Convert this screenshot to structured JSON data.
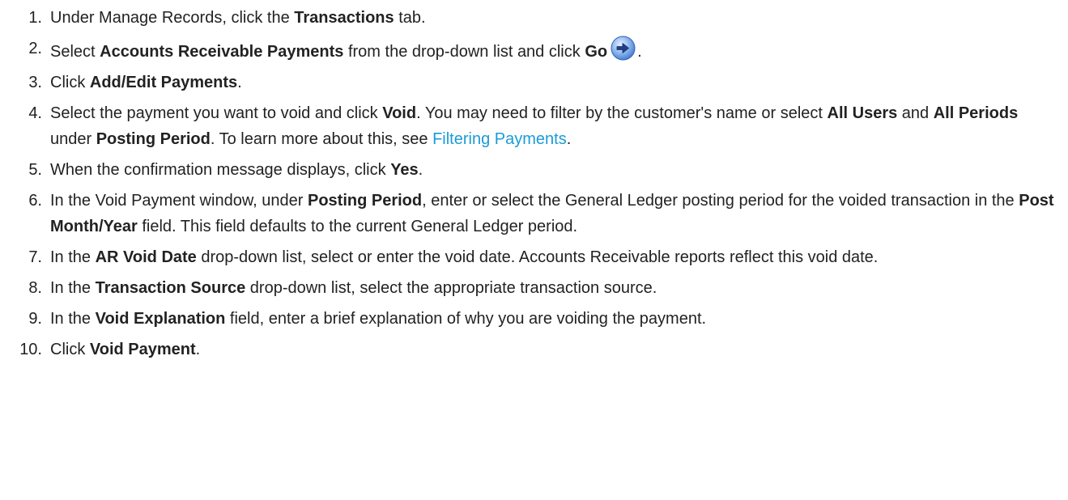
{
  "steps": [
    {
      "num": "1.",
      "parts": [
        {
          "t": "Under Manage Records, click the "
        },
        {
          "t": "Transactions",
          "b": true
        },
        {
          "t": " tab."
        }
      ]
    },
    {
      "num": "2.",
      "parts": [
        {
          "t": "Select "
        },
        {
          "t": "Accounts Receivable Payments",
          "b": true
        },
        {
          "t": " from the drop-down list and click "
        },
        {
          "t": "Go",
          "b": true
        },
        {
          "icon": "go-arrow-icon"
        },
        {
          "t": "."
        }
      ]
    },
    {
      "num": "3.",
      "parts": [
        {
          "t": "Click "
        },
        {
          "t": "Add/Edit Payments",
          "b": true
        },
        {
          "t": "."
        }
      ]
    },
    {
      "num": "4.",
      "parts": [
        {
          "t": "Select the payment you want to void and click "
        },
        {
          "t": "Void",
          "b": true
        },
        {
          "t": ". You may need to filter by the customer's name or select "
        },
        {
          "t": "All Users",
          "b": true
        },
        {
          "t": " and "
        },
        {
          "t": "All Periods",
          "b": true
        },
        {
          "t": " under "
        },
        {
          "t": "Posting Period",
          "b": true
        },
        {
          "t": ". To learn more about this, see "
        },
        {
          "t": "Filtering Payments",
          "link": true
        },
        {
          "t": "."
        }
      ]
    },
    {
      "num": "5.",
      "parts": [
        {
          "t": "When the confirmation message displays, click "
        },
        {
          "t": "Yes",
          "b": true
        },
        {
          "t": "."
        }
      ]
    },
    {
      "num": "6.",
      "parts": [
        {
          "t": "In the Void Payment window, under "
        },
        {
          "t": "Posting Period",
          "b": true
        },
        {
          "t": ", enter or select the General Ledger posting period for the voided transaction in the "
        },
        {
          "t": "Post Month/Year",
          "b": true
        },
        {
          "t": " field. This field defaults to the current General Ledger period."
        }
      ]
    },
    {
      "num": "7.",
      "parts": [
        {
          "t": "In the "
        },
        {
          "t": "AR Void Date",
          "b": true
        },
        {
          "t": " drop-down list, select or enter the void date. Accounts Receivable reports reflect this void date."
        }
      ]
    },
    {
      "num": "8.",
      "parts": [
        {
          "t": "In the "
        },
        {
          "t": "Transaction Source",
          "b": true
        },
        {
          "t": " drop-down list, select the appropriate transaction source."
        }
      ]
    },
    {
      "num": "9.",
      "parts": [
        {
          "t": "In the "
        },
        {
          "t": "Void Explanation",
          "b": true
        },
        {
          "t": " field, enter a brief explanation of why you are voiding the payment."
        }
      ]
    },
    {
      "num": "10.",
      "parts": [
        {
          "t": "Click "
        },
        {
          "t": "Void Payment",
          "b": true
        },
        {
          "t": "."
        }
      ]
    }
  ],
  "colors": {
    "text": "#222222",
    "link": "#1a9bd7",
    "icon_blue": "#2a6fd6"
  }
}
